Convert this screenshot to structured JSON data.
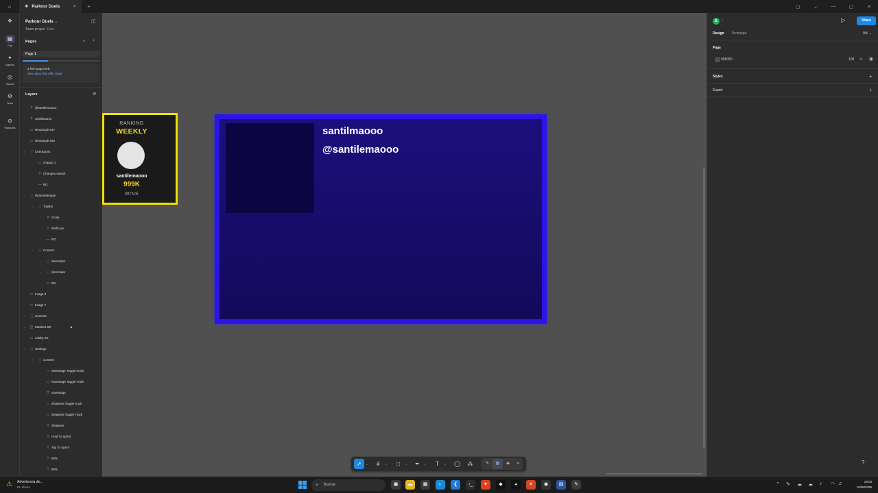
{
  "window": {
    "tab_title": "Parkour Duels",
    "home_icon": "home-icon",
    "close_tab_icon": "close-icon",
    "new_tab_icon": "plus-icon"
  },
  "rail": {
    "items": [
      {
        "label": "File",
        "icon": "file-icon"
      },
      {
        "label": "Agente",
        "icon": "sparkle-icon"
      },
      {
        "label": "Assets",
        "icon": "assets-icon"
      },
      {
        "label": "Tools",
        "icon": "tools-icon"
      },
      {
        "label": "Variables",
        "icon": "variables-icon"
      }
    ]
  },
  "left_panel": {
    "project_name": "Parkour Duels",
    "team": "Team project",
    "plan_badge": "Free",
    "pages_header": "Pages",
    "page_name": "Page 1",
    "free_pages_line1": "2 free pages left.",
    "free_pages_line2": "See plans that offer more",
    "pages_progress": 0.33,
    "layers_header": "Layers",
    "layers": [
      {
        "name": "@santilemaooo",
        "icon": "T",
        "depth": 0,
        "chev": ""
      },
      {
        "name": "santilmaooo",
        "icon": "T",
        "depth": 0,
        "chev": ""
      },
      {
        "name": "Rectangle 627",
        "icon": "▭",
        "depth": 0,
        "chev": ""
      },
      {
        "name": "Rectangle 626",
        "icon": "▭",
        "depth": 0,
        "chev": ""
      },
      {
        "name": "Checkpoint",
        "icon": "⬚",
        "depth": 0,
        "chev": "›"
      },
      {
        "name": "chaque 1",
        "icon": "▭",
        "depth": 1,
        "chev": ""
      },
      {
        "name": "Changes saved!",
        "icon": "T",
        "depth": 1,
        "chev": ""
      },
      {
        "name": "BG",
        "icon": "—",
        "depth": 1,
        "chev": ""
      },
      {
        "name": "ButtonManager",
        "icon": "⬚",
        "depth": 0,
        "chev": "›"
      },
      {
        "name": "TopBar",
        "icon": "⬚",
        "depth": 1,
        "chev": "›"
      },
      {
        "name": "Close",
        "icon": "#",
        "depth": 2,
        "chev": "›"
      },
      {
        "name": "ShiftLock",
        "icon": "T",
        "depth": 2,
        "chev": ""
      },
      {
        "name": "BG",
        "icon": "—",
        "depth": 2,
        "chev": ""
      },
      {
        "name": "Content",
        "icon": "⬚",
        "depth": 1,
        "chev": "›"
      },
      {
        "name": "SizeSlider",
        "icon": "⬚",
        "depth": 2,
        "chev": "›"
      },
      {
        "name": "SizeSlider",
        "icon": "⬚",
        "depth": 2,
        "chev": "›"
      },
      {
        "name": "BG",
        "icon": "▭",
        "depth": 2,
        "chev": ""
      },
      {
        "name": "Image 8",
        "icon": "▭",
        "depth": 0,
        "chev": ""
      },
      {
        "name": "Image 7",
        "icon": "▭",
        "depth": 0,
        "chev": ""
      },
      {
        "name": "Controls",
        "icon": "⬚",
        "depth": 0,
        "chev": "›"
      },
      {
        "name": "Masked BG",
        "icon": "◫",
        "depth": 0,
        "chev": "›",
        "locked": true
      },
      {
        "name": "Lobby SS",
        "icon": "▭",
        "depth": 0,
        "chev": ""
      },
      {
        "name": "Settings",
        "icon": "⬚",
        "depth": 0,
        "chev": "›"
      },
      {
        "name": "Content",
        "icon": "⬚",
        "depth": 1,
        "chev": "›"
      },
      {
        "name": "Nametage Toggle Knob",
        "icon": "○",
        "depth": 2,
        "chev": ""
      },
      {
        "name": "Nametage Toggle Track",
        "icon": "▭",
        "depth": 2,
        "chev": ""
      },
      {
        "name": "Nametage",
        "icon": "T",
        "depth": 2,
        "chev": ""
      },
      {
        "name": "Shadows Toggle Knob",
        "icon": "○",
        "depth": 2,
        "chev": ""
      },
      {
        "name": "Shadows Toggle Track",
        "icon": "▭",
        "depth": 2,
        "chev": ""
      },
      {
        "name": "Shadows",
        "icon": "T",
        "depth": 2,
        "chev": ""
      },
      {
        "name": "Hold To Sprint",
        "icon": "T",
        "depth": 2,
        "chev": ""
      },
      {
        "name": "Tap To Sprint",
        "icon": "T",
        "depth": 2,
        "chev": ""
      },
      {
        "name": "50%",
        "icon": "T",
        "depth": 2,
        "chev": ""
      },
      {
        "name": "50%",
        "icon": "T",
        "depth": 2,
        "chev": ""
      }
    ]
  },
  "canvas": {
    "ranking": {
      "label_top": "RANKING",
      "label_period": "WEEKLY",
      "player_name": "santilemaooo",
      "value": "999K",
      "unit": "WINS",
      "border_color": "#f0e000",
      "accent_color": "#f0d020"
    },
    "card": {
      "username": "santilmaooo",
      "handle": "@santilemaooo",
      "border_color": "#2a14e6",
      "fill_color": "#1c0f7c"
    },
    "background_color": "#505050"
  },
  "toolbar": {
    "tools": [
      {
        "name": "move-tool",
        "icon": "➚",
        "selected": true
      },
      {
        "name": "frame-tool",
        "icon": "#"
      },
      {
        "name": "rectangle-tool",
        "icon": "□"
      },
      {
        "name": "pen-tool",
        "icon": "✒"
      },
      {
        "name": "text-tool",
        "icon": "T"
      },
      {
        "name": "comment-tool",
        "icon": "◯"
      },
      {
        "name": "actions-tool",
        "icon": "⁂"
      }
    ],
    "modes": [
      {
        "name": "draw-mode",
        "icon": "✎"
      },
      {
        "name": "design-mode",
        "icon": "▦"
      },
      {
        "name": "prototype-mode",
        "icon": "◈"
      },
      {
        "name": "dev-mode",
        "icon": "‹›"
      }
    ]
  },
  "right_panel": {
    "user_initial": "S",
    "share_label": "Share",
    "tab_design": "Design",
    "tab_prototype": "Prototype",
    "zoom": "9%",
    "page_label": "Page",
    "page_color_hex": "505050",
    "page_opacity": "100",
    "page_opacity_unit": "%",
    "styles_label": "Styles",
    "export_label": "Export",
    "accent_color": "#1e88e5"
  },
  "taskbar": {
    "warning_title": "Advertencia de...",
    "warning_sub": "En efecto",
    "search_placeholder": "Buscar",
    "time": "18:03",
    "date": "12/08/2026",
    "apps": [
      {
        "name": "task-view-icon",
        "glyph": "▣",
        "color": "#3a3a3a"
      },
      {
        "name": "file-explorer-icon",
        "glyph": "▬",
        "color": "#e8b321"
      },
      {
        "name": "calculator-icon",
        "glyph": "▦",
        "color": "#3a3a3a"
      },
      {
        "name": "edge-icon",
        "glyph": "◐",
        "color": "#1a8ad4"
      },
      {
        "name": "vscode-icon",
        "glyph": "❮",
        "color": "#1f7ad6"
      },
      {
        "name": "terminal-icon",
        "glyph": "›_",
        "color": "#2d2d2d"
      },
      {
        "name": "brave-icon",
        "glyph": "▼",
        "color": "#d8431e"
      },
      {
        "name": "roblox-icon",
        "glyph": "◆",
        "color": "#111111"
      },
      {
        "name": "figma-icon",
        "glyph": "◕",
        "color": "#111111"
      },
      {
        "name": "roblox-studio-icon",
        "glyph": "✕",
        "color": "#d24726"
      },
      {
        "name": "chrome-icon",
        "glyph": "◉",
        "color": "#333333"
      },
      {
        "name": "word-icon",
        "glyph": "▤",
        "color": "#2b579a"
      },
      {
        "name": "editor-icon",
        "glyph": "✎",
        "color": "#3a3a3a"
      }
    ]
  }
}
